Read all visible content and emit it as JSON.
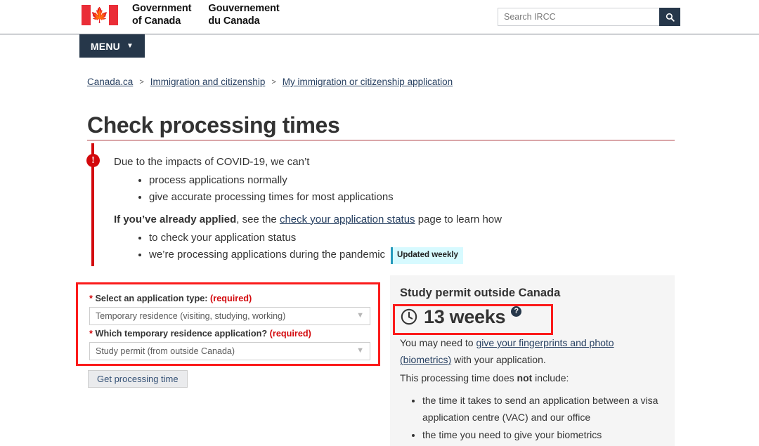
{
  "header": {
    "flag_alt": "canada-flag",
    "wordmark_en_line1": "Government",
    "wordmark_en_line2": "of Canada",
    "wordmark_fr_line1": "Gouvernement",
    "wordmark_fr_line2": "du Canada",
    "search_placeholder": "Search IRCC",
    "search_value": "",
    "search_button_label": "search-icon"
  },
  "menu": {
    "label": "MENU",
    "chevron": "⌄"
  },
  "breadcrumb": {
    "separator": ">",
    "items": [
      {
        "label": "Canada.ca"
      },
      {
        "label": "Immigration and citizenship"
      },
      {
        "label": "My immigration or citizenship application"
      }
    ]
  },
  "page": {
    "title": "Check processing times"
  },
  "alert": {
    "icon": "!",
    "lead": "Due to the impacts of COVID-19, we can’t",
    "bullets_1": [
      "process applications normally",
      "give accurate processing times for most applications"
    ],
    "second_lead_bold": "If you’ve already applied",
    "second_lead_mid": ", see the ",
    "second_lead_link": "check your application status",
    "second_lead_end": " page to learn how",
    "bullets_2": [
      "to check your application status",
      "we’re processing applications during the pandemic"
    ],
    "badge": "Updated weekly"
  },
  "form": {
    "field1": {
      "star": "*",
      "label": "Select an application type:",
      "required": "(required)",
      "value": "Temporary residence (visiting, studying, working)",
      "chevron": "⌄"
    },
    "field2": {
      "star": "*",
      "label": "Which temporary residence application?",
      "required": "(required)",
      "value": "Study permit (from outside Canada)",
      "chevron": "⌄"
    },
    "submit_label": "Get processing time"
  },
  "result": {
    "title": "Study permit outside Canada",
    "clock_icon": "clock-icon",
    "time": "13 weeks",
    "help_icon": "?",
    "body_1_pre": "You may need to ",
    "body_1_link": "give your fingerprints and photo (biometrics)",
    "body_1_post": " with your application.",
    "body_2_pre": "This processing time does ",
    "body_2_bold": "not",
    "body_2_post": " include:",
    "exclusions": [
      "the time it takes to send an application between a visa application centre (VAC) and our office",
      "the time you need to give your biometrics"
    ]
  },
  "colors": {
    "gc_navy": "#26374a",
    "flag_red": "#ea2d37",
    "alert_red": "#d3080c",
    "highlight_red": "#fb1b1b",
    "title_rule": "#af3c43",
    "link_blue": "#284162",
    "badge_bg": "#d7faff",
    "badge_border": "#269abc",
    "panel_bg": "#f5f5f5"
  }
}
